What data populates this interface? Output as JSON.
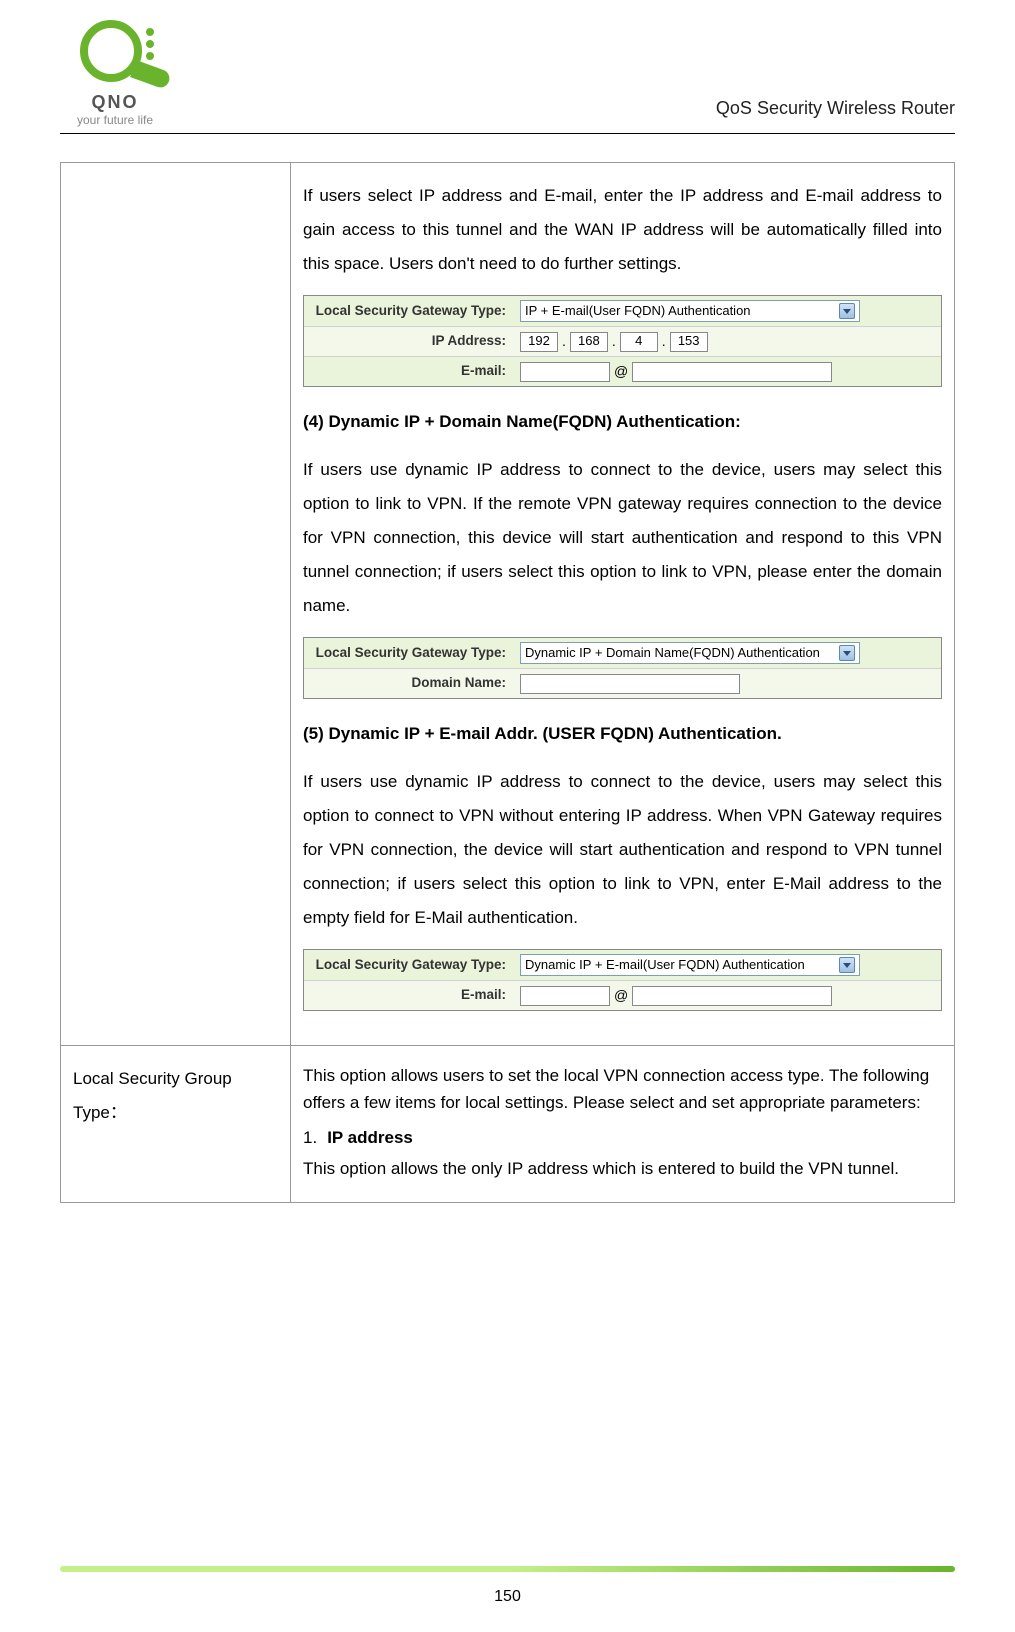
{
  "header": {
    "logo_text": "QNO",
    "tagline": "your future life",
    "product_title": "QoS Security Wireless Router"
  },
  "cell1": {
    "p1": "If users select IP address and E-mail, enter the IP address and E-mail address to gain access to this tunnel and the WAN IP address will be automatically filled into this space. Users don't need to do further settings.",
    "form1": {
      "label_type": "Local Security Gateway Type:",
      "select_type": "IP + E-mail(User FQDN) Authentication",
      "label_ip": "IP Address:",
      "ip": [
        "192",
        "168",
        "4",
        "153"
      ],
      "label_email": "E-mail:",
      "at": "@"
    },
    "h4": "(4) Dynamic IP + Domain Name(FQDN) Authentication:",
    "p4": "If users use dynamic IP address to connect to the device, users may select this option to link to VPN. If the remote VPN gateway requires connection to the device for VPN connection, this device will start authentication and respond to this VPN tunnel connection; if users select this option to link to VPN, please enter the domain name.",
    "form4": {
      "label_type": "Local Security Gateway Type:",
      "select_type": "Dynamic IP + Domain Name(FQDN) Authentication",
      "label_domain": "Domain Name:"
    },
    "h5": "(5) Dynamic IP + E-mail Addr. (USER FQDN) Authentication.",
    "p5": "If users use dynamic IP address to connect to the device, users may select this option to connect to VPN without entering IP address. When VPN Gateway requires for VPN connection, the device will start authentication and respond to VPN tunnel connection; if users select this option to link to VPN, enter E-Mail address to the empty field for E-Mail authentication.",
    "form5": {
      "label_type": "Local Security Gateway Type:",
      "select_type": "Dynamic IP + E-mail(User FQDN) Authentication",
      "label_email": "E-mail:",
      "at": "@"
    }
  },
  "cell2_left": "Local Security Group Type：",
  "cell2": {
    "intro": "This option allows users to set the local VPN connection access type. The following offers a few items for local settings. Please select and set appropriate parameters:",
    "item1_num": "1.",
    "item1_title": "IP address",
    "item1_text": "This option allows the only IP address which is entered to build the VPN tunnel."
  },
  "page_number": "150"
}
